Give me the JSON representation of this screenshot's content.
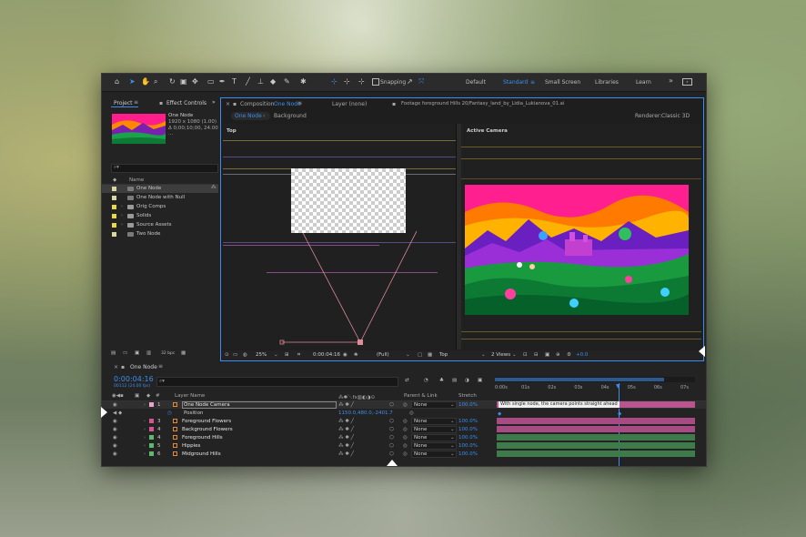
{
  "toolbar": {
    "snapping_label": "Snapping",
    "workspaces": [
      "Default",
      "Standard",
      "Small Screen",
      "Libraries",
      "Learn"
    ],
    "active_workspace": "Standard",
    "more": "»"
  },
  "project_panel": {
    "tab_label": "Project",
    "effect_controls_label": "Effect Controls",
    "preview_name": "One Node",
    "preview_info1": "1920 x 1080 (1.00)",
    "preview_info2": "Δ 0;00;10;00, 24.00 ...",
    "search_placeholder": "⌕▾",
    "name_header": "Name",
    "items": [
      {
        "name": "One Node",
        "color": "#d8d8a0",
        "selected": true,
        "type": "comp"
      },
      {
        "name": "One Node with Null",
        "color": "#d8d8a0",
        "type": "comp"
      },
      {
        "name": "Orig Comps",
        "color": "#e8d84a",
        "type": "folder"
      },
      {
        "name": "Solids",
        "color": "#e8d84a",
        "type": "folder"
      },
      {
        "name": "Source Assets",
        "color": "#e8d84a",
        "type": "folder"
      },
      {
        "name": "Two Node",
        "color": "#d8d8a0",
        "type": "comp"
      }
    ],
    "bpc": "32 bpc"
  },
  "comp_panel": {
    "tab_label": "Composition",
    "comp_name": "One Node",
    "layer_label": "Layer (none)",
    "footage_label": "Footage foreground Hills 20/Fantasy_land_by_Lidia_Lukianova_01.ai",
    "subtab1": "One Node",
    "subtab2": "Background",
    "renderer_label": "Renderer:",
    "renderer_value": "Classic 3D",
    "view_left": "Top",
    "view_right": "Active Camera",
    "zoom": "25%",
    "timecode": "0:00:04:16",
    "resolution": "(Full)",
    "view_select": "Top",
    "views_select": "2 Views",
    "exposure": "+0.0"
  },
  "timeline": {
    "tab_label": "One Node",
    "timecode": "0:00:04:16",
    "frames": "00112 (24.00 fps)",
    "search_placeholder": "⌕▾",
    "col_layer_name": "Layer Name",
    "col_parent": "Parent & Link",
    "col_stretch": "Stretch",
    "ruler": [
      "0:00s",
      "01s",
      "02s",
      "03s",
      "04s",
      "05s",
      "06s",
      "07s"
    ],
    "layers": [
      {
        "num": "1",
        "name": "One Node Camera",
        "parent": "None",
        "stretch": "100.0%",
        "color": "#e9a4c8",
        "bar_color": "#b8548e",
        "bar_label": "With single node, the camera points straight ahead"
      },
      {
        "num": "",
        "name": "Position",
        "value": "1150.0,480.0,-2401.7",
        "is_property": true
      },
      {
        "num": "3",
        "name": "Foreground Flowers",
        "parent": "None",
        "stretch": "100.0%",
        "color": "#d0578f",
        "bar_color": "#a84b85"
      },
      {
        "num": "4",
        "name": "Background Flowers",
        "parent": "None",
        "stretch": "100.0%",
        "color": "#d0578f",
        "bar_color": "#a84b85"
      },
      {
        "num": "4",
        "name": "Foreground Hills",
        "parent": "None",
        "stretch": "100.0%",
        "color": "#5cba6e",
        "bar_color": "#3f7a4a"
      },
      {
        "num": "5",
        "name": "Hippies",
        "parent": "None",
        "stretch": "100.0%",
        "color": "#5cba6e",
        "bar_color": "#3f7a4a"
      },
      {
        "num": "6",
        "name": "Midground Hills",
        "parent": "None",
        "stretch": "100.0%",
        "color": "#5cba6e",
        "bar_color": "#3f7a4a"
      }
    ]
  },
  "icons": [
    "home-icon",
    "selection-tool-icon",
    "hand-tool-icon",
    "zoom-tool-icon",
    "rotate-tool-icon",
    "camera-tool-icon",
    "pan-behind-icon",
    "mask-tool-icon",
    "pen-tool-icon",
    "type-tool-icon",
    "brush-tool-icon",
    "clone-stamp-icon",
    "eraser-icon",
    "roto-brush-icon",
    "puppet-pin-icon",
    "snapping-checkbox-icon",
    "workspace-menu-icon",
    "search-icon",
    "folder-icon",
    "comp-icon",
    "camera-layer-icon",
    "eye-icon",
    "lock-icon",
    "stopwatch-icon"
  ]
}
